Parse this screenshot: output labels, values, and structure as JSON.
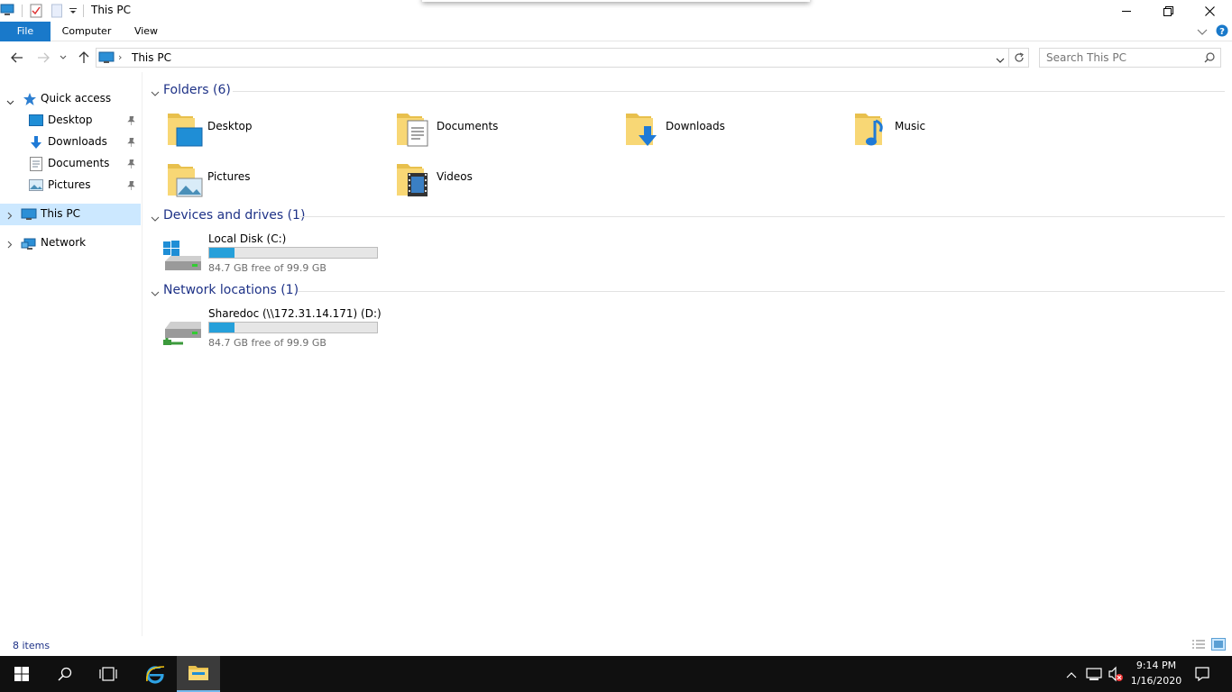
{
  "window": {
    "title": "This PC"
  },
  "ribbon": {
    "tabs": [
      {
        "label": "File"
      },
      {
        "label": "Computer"
      },
      {
        "label": "View"
      }
    ]
  },
  "address": {
    "path": "This PC"
  },
  "search": {
    "placeholder": "Search This PC"
  },
  "nav": {
    "quick_access": "Quick access",
    "pinned": [
      {
        "label": "Desktop"
      },
      {
        "label": "Downloads"
      },
      {
        "label": "Documents"
      },
      {
        "label": "Pictures"
      }
    ],
    "this_pc": "This PC",
    "network": "Network"
  },
  "groups": {
    "folders": {
      "label": "Folders (6)",
      "items": [
        {
          "label": "Desktop"
        },
        {
          "label": "Documents"
        },
        {
          "label": "Downloads"
        },
        {
          "label": "Music"
        },
        {
          "label": "Pictures"
        },
        {
          "label": "Videos"
        }
      ]
    },
    "devices": {
      "label": "Devices and drives (1)",
      "items": [
        {
          "name": "Local Disk (C:)",
          "free": "84.7 GB free of 99.9 GB",
          "used_fraction": 0.152
        }
      ]
    },
    "network": {
      "label": "Network locations (1)",
      "items": [
        {
          "name": "Sharedoc (\\\\172.31.14.171) (D:)",
          "free": "84.7 GB free of 99.9 GB",
          "used_fraction": 0.152
        }
      ]
    }
  },
  "status": {
    "items": "8 items"
  },
  "taskbar": {
    "time": "9:14 PM",
    "date": "1/16/2020"
  },
  "colors": {
    "accent": "#1979ca",
    "group_header": "#1e3287",
    "selection": "#cce8ff",
    "drive_fill": "#26a0da",
    "taskbar": "#101010"
  }
}
